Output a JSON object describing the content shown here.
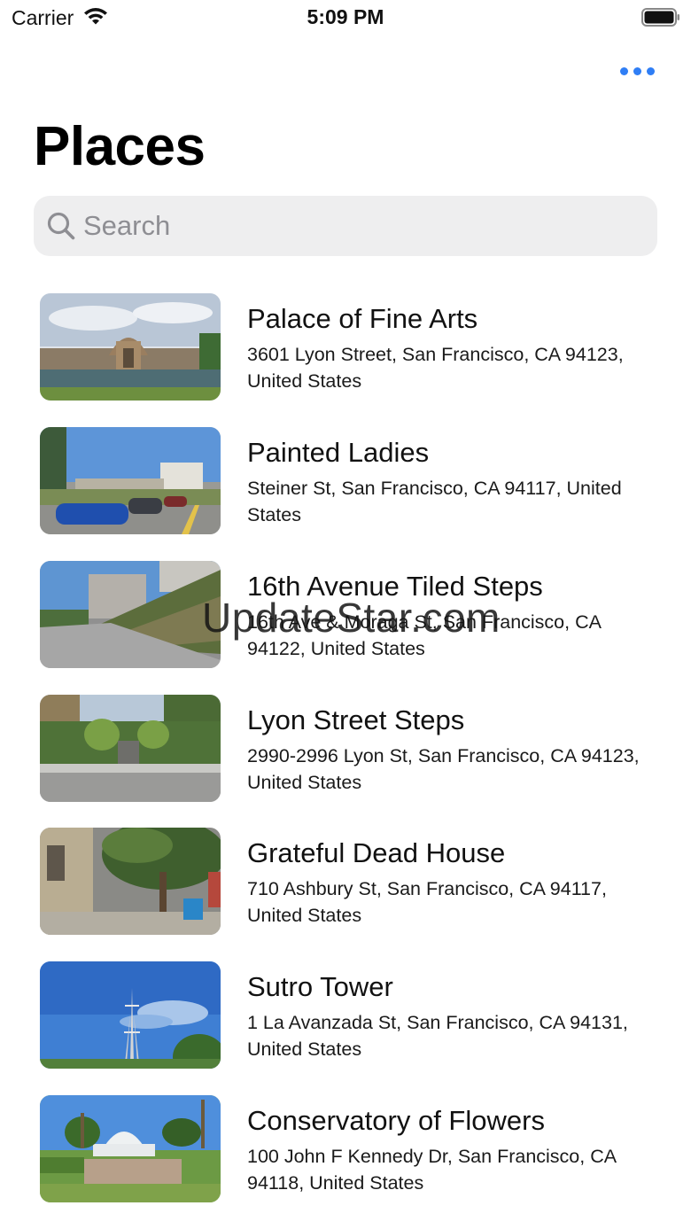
{
  "status_bar": {
    "carrier": "Carrier",
    "time": "5:09 PM",
    "wifi_icon": "wifi-icon",
    "battery_icon": "battery-icon"
  },
  "nav": {
    "more_icon": "ellipsis-icon",
    "accent_color": "#2f7ef5"
  },
  "title": "Places",
  "search": {
    "placeholder": "Search",
    "value": "",
    "icon": "search-icon"
  },
  "places": [
    {
      "name": "Palace of Fine Arts",
      "address": "3601 Lyon Street, San Francisco, CA 94123, United States"
    },
    {
      "name": "Painted Ladies",
      "address": "Steiner St, San Francisco, CA 94117, United States"
    },
    {
      "name": "16th Avenue Tiled Steps",
      "address": "16th Ave & Moraga St, San Francisco, CA 94122, United States"
    },
    {
      "name": "Lyon Street Steps",
      "address": "2990-2996 Lyon St, San Francisco, CA 94123, United States"
    },
    {
      "name": "Grateful Dead House",
      "address": "710 Ashbury St, San Francisco, CA  94117, United States"
    },
    {
      "name": "Sutro Tower",
      "address": "1 La Avanzada St, San Francisco, CA 94131, United States"
    },
    {
      "name": "Conservatory of Flowers",
      "address": "100 John F Kennedy Dr, San Francisco, CA 94118, United States"
    }
  ],
  "watermark": "UpdateStar.com"
}
